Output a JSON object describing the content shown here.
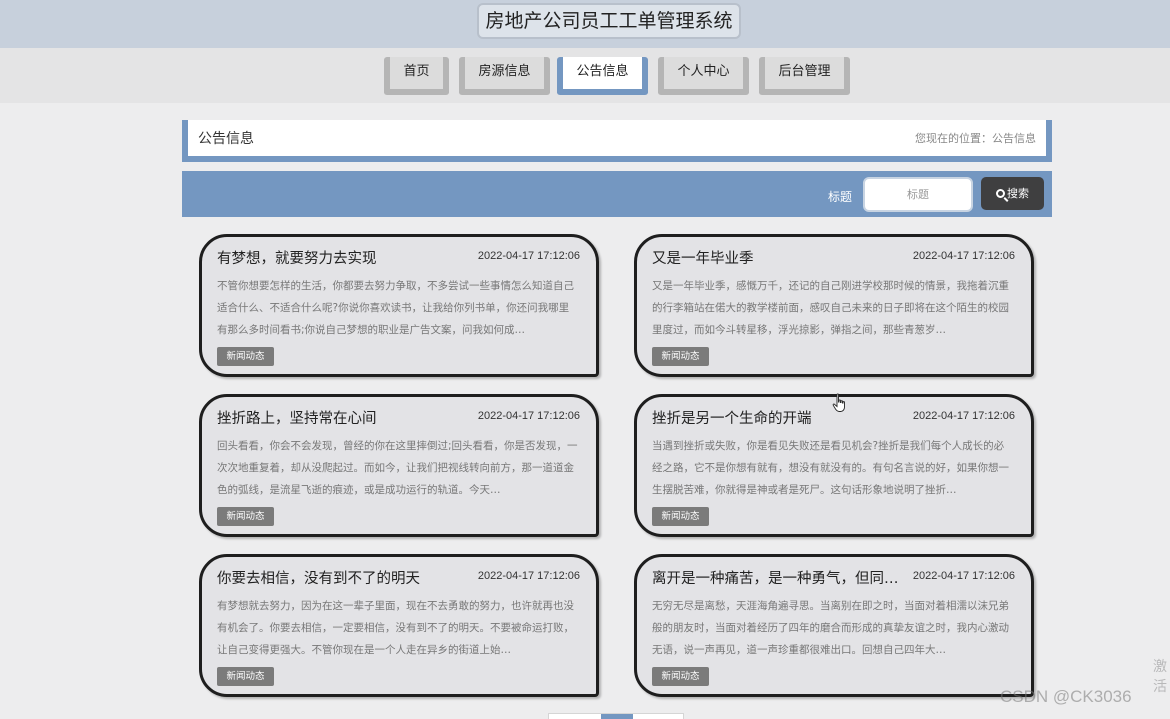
{
  "site": {
    "title": "房地产公司员工工单管理系统"
  },
  "nav": {
    "items": [
      {
        "label": "首页"
      },
      {
        "label": "房源信息"
      },
      {
        "label": "公告信息"
      },
      {
        "label": "个人中心"
      },
      {
        "label": "后台管理"
      }
    ],
    "active_index": 2
  },
  "panel": {
    "title": "公告信息",
    "breadcrumb": "您现在的位置：公告信息"
  },
  "search": {
    "label": "标题",
    "placeholder": "标题",
    "button_label": "搜索"
  },
  "cards": [
    {
      "title": "有梦想，就要努力去实现",
      "time": "2022-04-17 17:12:06",
      "summary": "不管你想要怎样的生活，你都要去努力争取，不多尝试一些事情怎么知道自己适合什么、不适合什么呢?你说你喜欢读书，让我给你列书单，你还问我哪里有那么多时间看书;你说自己梦想的职业是广告文案，问我如何成…",
      "tag": "新闻动态"
    },
    {
      "title": "又是一年毕业季",
      "time": "2022-04-17 17:12:06",
      "summary": "又是一年毕业季，感慨万千，还记的自己刚进学校那时候的情景，我拖着沉重的行李箱站在偌大的教学楼前面，感叹自己未来的日子即将在这个陌生的校园里度过，而如今斗转星移，浮光掠影，弹指之间，那些青葱岁…",
      "tag": "新闻动态"
    },
    {
      "title": "挫折路上，坚持常在心间",
      "time": "2022-04-17 17:12:06",
      "summary": "回头看看，你会不会发现，曾经的你在这里摔倒过;回头看看，你是否发现，一次次地重复着，却从没爬起过。而如今，让我们把视线转向前方，那一道道金色的弧线，是流星飞逝的痕迹，或是成功运行的轨道。今天…",
      "tag": "新闻动态"
    },
    {
      "title": "挫折是另一个生命的开端",
      "time": "2022-04-17 17:12:06",
      "summary": "当遇到挫折或失败，你是看见失败还是看见机会?挫折是我们每个人成长的必经之路，它不是你想有就有，想没有就没有的。有句名言说的好，如果你想一生摆脱苦难，你就得是神或者是死尸。这句话形象地说明了挫折…",
      "tag": "新闻动态"
    },
    {
      "title": "你要去相信，没有到不了的明天",
      "time": "2022-04-17 17:12:06",
      "summary": "有梦想就去努力，因为在这一辈子里面，现在不去勇敢的努力，也许就再也没有机会了。你要去相信，一定要相信，没有到不了的明天。不要被命运打败，让自己变得更强大。不管你现在是一个人走在异乡的街道上始…",
      "tag": "新闻动态"
    },
    {
      "title": "离开是一种痛苦，是一种勇气，但同样…",
      "time": "2022-04-17 17:12:06",
      "summary": "无穷无尽是离愁，天涯海角遍寻思。当离别在即之时，当面对着相濡以沫兄弟般的朋友时，当面对着经历了四年的磨合而形成的真挚友谊之时，我内心激动无语，说一声再见，道一声珍重都很难出口。回想自己四年大…",
      "tag": "新闻动态"
    }
  ],
  "watermark": {
    "text": "CSDN @CK3036",
    "side_text": "激活"
  }
}
